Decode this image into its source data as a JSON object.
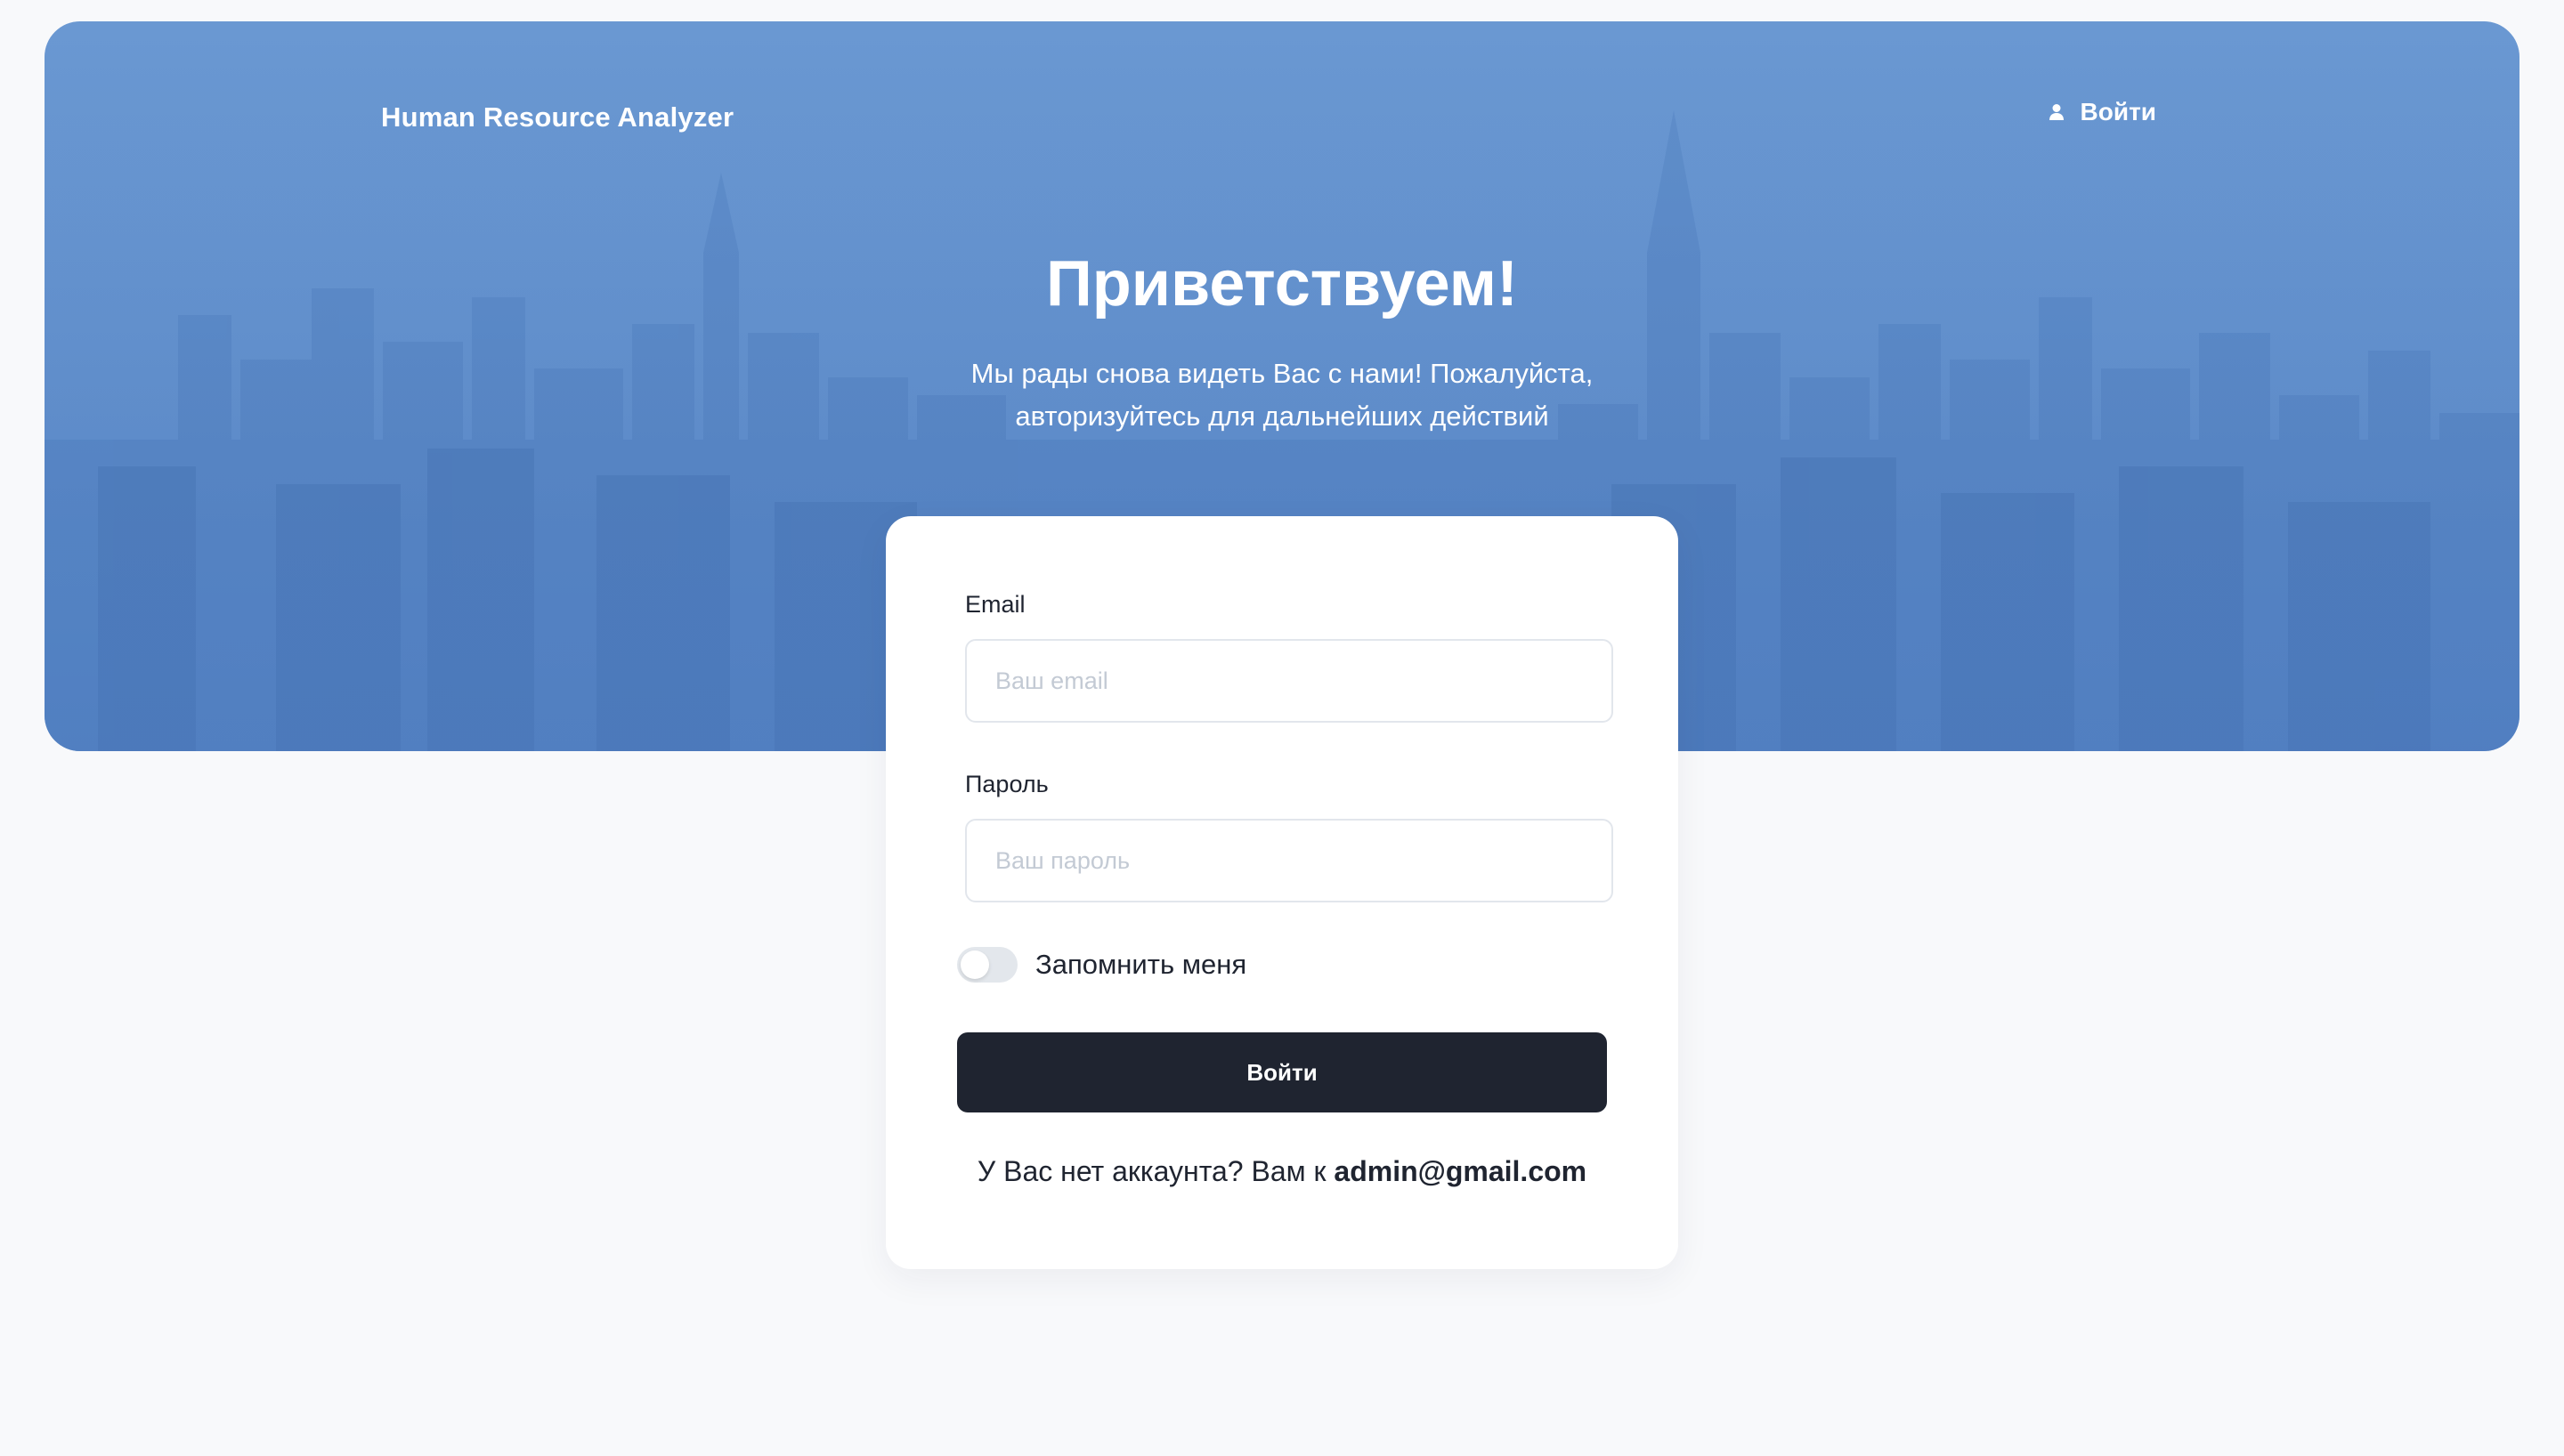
{
  "header": {
    "brand": "Human Resource Analyzer",
    "login_link": "Войти",
    "login_icon": "user-icon"
  },
  "hero": {
    "title": "Приветствуем!",
    "subtitle_line1": "Мы рады снова видеть Вас с нами! Пожалуйста,",
    "subtitle_line2": "авторизуйтесь для дальнейших действий"
  },
  "form": {
    "email_label": "Email",
    "email_placeholder": "Ваш email",
    "email_value": "",
    "password_label": "Пароль",
    "password_placeholder": "Ваш пароль",
    "password_value": "",
    "remember_label": "Запомнить меня",
    "remember_checked": false,
    "submit_label": "Войти",
    "no_account_text": "У Вас нет аккаунта? Вам к",
    "contact_email": "admin@gmail.com"
  },
  "colors": {
    "hero_blue": "#6a98d2",
    "button_dark": "#1f2430",
    "page_bg": "#f8f9fb"
  }
}
